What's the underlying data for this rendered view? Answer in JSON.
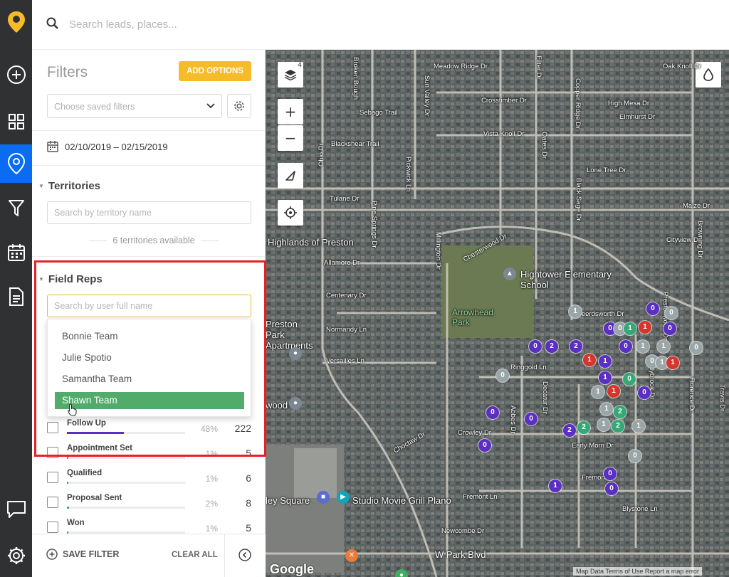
{
  "search": {
    "placeholder": "Search leads, places..."
  },
  "nav": {
    "items": [
      {
        "icon": "add-circle-icon"
      },
      {
        "icon": "dashboard-grid-icon"
      },
      {
        "icon": "map-pin-icon",
        "active": true
      },
      {
        "icon": "filter-funnel-icon"
      },
      {
        "icon": "calendar-icon"
      },
      {
        "icon": "document-icon"
      },
      {
        "icon": "chat-icon"
      },
      {
        "icon": "settings-gear-icon"
      }
    ]
  },
  "filters": {
    "title": "Filters",
    "add_options_label": "ADD OPTIONS",
    "saved_filters_placeholder": "Choose saved filters",
    "date_range": "02/10/2019 – 02/15/2019",
    "territories": {
      "title": "Territories",
      "search_placeholder": "Search by territory name",
      "available_text": "6 territories available"
    },
    "field_reps": {
      "title": "Field Reps",
      "search_placeholder": "Search by user full name",
      "dropdown": [
        "Bonnie Team",
        "Julie Spotio",
        "Samantha Team",
        "Shawn Team"
      ],
      "selected": "Shawn Team"
    },
    "stages": [
      {
        "name": "Follow Up",
        "percent": "48%",
        "count": "222",
        "fill": 0.48,
        "color": "#5a2fc2"
      },
      {
        "name": "Appointment Set",
        "percent": "1%",
        "count": "5",
        "fill": 0.01,
        "color": "#36a877"
      },
      {
        "name": "Qualified",
        "percent": "1%",
        "count": "6",
        "fill": 0.01,
        "color": "#36a877"
      },
      {
        "name": "Proposal Sent",
        "percent": "2%",
        "count": "8",
        "fill": 0.02,
        "color": "#36a877"
      },
      {
        "name": "Won",
        "percent": "1%",
        "count": "5",
        "fill": 0.01,
        "color": "#36a877"
      }
    ],
    "footer": {
      "save_label": "SAVE FILTER",
      "clear_label": "CLEAR ALL"
    }
  },
  "map": {
    "layers_badge": "4",
    "streets": [
      "Meadow Ridge Dr",
      "Broken Bough",
      "Filter Dr",
      "Sebago Trail",
      "Sun Valley Dr",
      "Crosstimber Dr",
      "Copper Ridge Dr",
      "Oak Knoll Dr",
      "High Mesa Dr",
      "Elmhurst Dr",
      "Vista Knoll Dr",
      "Oates Dr",
      "Blackshear Trail",
      "Ohio Dr",
      "Pickwick Ln",
      "Lone Tree Dr",
      "Tulane Dr",
      "Black Sage Dr",
      "Maize Dr",
      "Pine Springs Dr",
      "Millington Dr",
      "Chesterwood Dr",
      "Cityview Dr",
      "Browning Dr",
      "Allamore Dr",
      "Centenary Dr",
      "Normandy Ln",
      "Versailles Ln",
      "Deerdsworth Dr",
      "Prestonwood Dr",
      "Ringgold Ln",
      "Shadybrook Dr",
      "Crowley Dr",
      "Choctaw Dr",
      "Abbes Dr",
      "Decatur Dr",
      "Early Morn Dr",
      "Florence Dr",
      "Travis Dr",
      "Fremont Ln",
      "Blystone Ln",
      "Newcombe Dr",
      "W Park Blvd",
      "Fremont Dr"
    ],
    "places": {
      "highlands": "Highlands of Preston",
      "school": "Hightower Elementary School",
      "park": "Arrowhead Park",
      "apartments": "Preston Park Apartments",
      "wood": "wood",
      "square": "ley Square",
      "cinema": "Studio Movie Grill Plano"
    },
    "pins": [
      {
        "v": "0",
        "c": "purple"
      },
      {
        "v": "0",
        "c": "gray"
      },
      {
        "v": "1",
        "c": "gray"
      },
      {
        "v": "0",
        "c": "purple"
      },
      {
        "v": "0",
        "c": "gray"
      },
      {
        "v": "1",
        "c": "green"
      },
      {
        "v": "1",
        "c": "red"
      },
      {
        "v": "0",
        "c": "purple"
      },
      {
        "v": "0",
        "c": "purple"
      },
      {
        "v": "2",
        "c": "purple"
      },
      {
        "v": "2",
        "c": "purple"
      },
      {
        "v": "0",
        "c": "purple"
      },
      {
        "v": "1",
        "c": "gray"
      },
      {
        "v": "1",
        "c": "gray"
      },
      {
        "v": "0",
        "c": "gray"
      },
      {
        "v": "1",
        "c": "red"
      },
      {
        "v": "1",
        "c": "purple"
      },
      {
        "v": "0",
        "c": "gray"
      },
      {
        "v": "1",
        "c": "gray"
      },
      {
        "v": "1",
        "c": "red"
      },
      {
        "v": "0",
        "c": "gray"
      },
      {
        "v": "1",
        "c": "purple"
      },
      {
        "v": "0",
        "c": "green"
      },
      {
        "v": "1",
        "c": "gray"
      },
      {
        "v": "1",
        "c": "red"
      },
      {
        "v": "0",
        "c": "purple"
      },
      {
        "v": "1",
        "c": "gray"
      },
      {
        "v": "2",
        "c": "green"
      },
      {
        "v": "0",
        "c": "purple"
      },
      {
        "v": "0",
        "c": "purple"
      },
      {
        "v": "2",
        "c": "purple"
      },
      {
        "v": "2",
        "c": "green"
      },
      {
        "v": "1",
        "c": "gray"
      },
      {
        "v": "2",
        "c": "green"
      },
      {
        "v": "1",
        "c": "gray"
      },
      {
        "v": "0",
        "c": "purple"
      },
      {
        "v": "0",
        "c": "gray"
      },
      {
        "v": "0",
        "c": "purple"
      },
      {
        "v": "1",
        "c": "purple"
      },
      {
        "v": "0",
        "c": "purple"
      }
    ],
    "attribution": "Map Data   Terms of Use   Report a map error"
  }
}
